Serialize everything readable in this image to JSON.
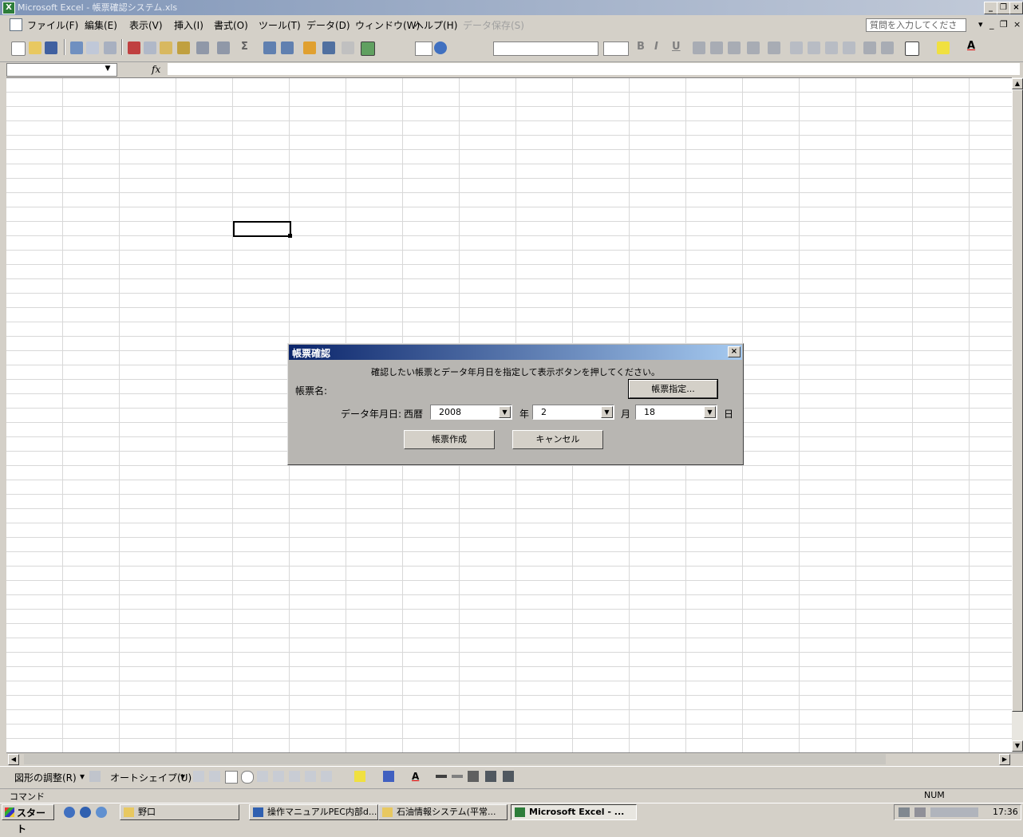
{
  "window": {
    "title": "Microsoft Excel - 帳票確認システム.xls"
  },
  "menu": {
    "items": [
      "ファイル(F)",
      "編集(E)",
      "表示(V)",
      "挿入(I)",
      "書式(O)",
      "ツール(T)",
      "データ(D)",
      "ウィンドウ(W)",
      "ヘルプ(H)"
    ],
    "disabled_item": "データ保存(S)",
    "question_placeholder": "質問を入力してください"
  },
  "formula": {
    "fx": "fx"
  },
  "dialog": {
    "title": "帳票確認",
    "close": "×",
    "instruction": "確認したい帳票とデータ年月日を指定して表示ボタンを押してください。",
    "label_report_name": "帳票名:",
    "button_specify": "帳票指定...",
    "label_data_date": "データ年月日:",
    "label_era": "西暦",
    "year": "2008",
    "year_unit": "年",
    "month": "2",
    "month_unit": "月",
    "day": "18",
    "day_unit": "日",
    "button_create": "帳票作成",
    "button_cancel": "キャンセル"
  },
  "drawing_toolbar": {
    "adjust": "図形の調整(R)",
    "autoshape": "オートシェイプ(U)"
  },
  "status": {
    "mode": "コマンド",
    "num": "NUM"
  },
  "taskbar": {
    "start": "スタート",
    "tasks": [
      "野口",
      "操作マニュアルPEC内部d...",
      "石油情報システム(平常...",
      "Microsoft Excel - ..."
    ],
    "clock": "17:36"
  },
  "colors": {
    "dialog_title": "#0a246a",
    "grid": "#d8d8d8"
  }
}
